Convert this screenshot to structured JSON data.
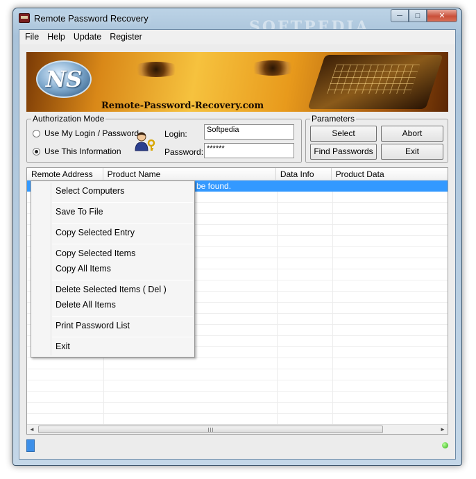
{
  "window": {
    "title": "Remote Password Recovery",
    "controls": {
      "minimize": "─",
      "maximize": "□",
      "close": "✕"
    }
  },
  "menubar": [
    "File",
    "Help",
    "Update",
    "Register"
  ],
  "banner": {
    "logo_text": "NS",
    "site": "Remote-Password-Recovery.com"
  },
  "auth": {
    "legend": "Authorization Mode",
    "option_login": "Use My Login / Password",
    "option_info": "Use This Information",
    "selected": "option_info",
    "login_label": "Login:",
    "login_value": "Softpedia",
    "password_label": "Password:",
    "password_value": "******"
  },
  "params": {
    "legend": "Parameters",
    "select_computers": "Select Computers",
    "abort": "Abort",
    "find_passwords": "Find Passwords",
    "exit": "Exit"
  },
  "list": {
    "columns": [
      "Remote Address",
      "Product Name",
      "Data Info",
      "Product Data"
    ],
    "selected_row_text": "be found."
  },
  "context_menu": {
    "select_computers": "Select Computers",
    "save_to_file": "Save To File",
    "copy_selected_entry": "Copy Selected Entry",
    "copy_selected_items": "Copy Selected Items",
    "copy_all_items": "Copy All Items",
    "delete_selected_items": "Delete Selected Items ( Del )",
    "delete_all_items": "Delete All Items",
    "print_password_list": "Print Password List",
    "exit": "Exit"
  },
  "scrollbar": {
    "left": "◄",
    "right": "►"
  },
  "colors": {
    "selection": "#3399ff",
    "status_ok": "#2fae12",
    "progress": "#3d8fe8"
  }
}
